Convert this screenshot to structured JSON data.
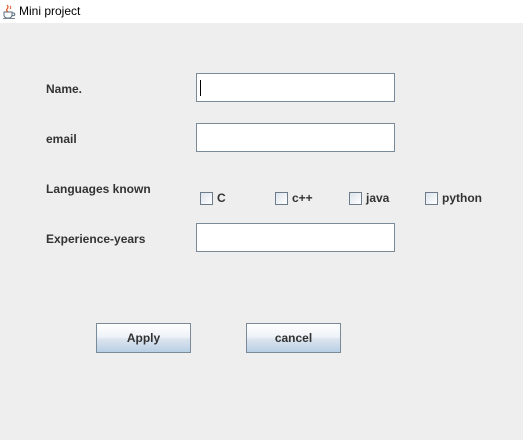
{
  "window": {
    "title": "Mini project",
    "icon": "java-cup-icon"
  },
  "form": {
    "name_label": "Name.",
    "name_value": "",
    "email_label": "email",
    "email_value": "",
    "languages_label": "Languages known",
    "languages": [
      {
        "label": "C",
        "checked": false
      },
      {
        "label": "c++",
        "checked": false
      },
      {
        "label": "java",
        "checked": false
      },
      {
        "label": "python",
        "checked": false
      }
    ],
    "experience_label": "Experience-years",
    "experience_value": ""
  },
  "buttons": {
    "apply_label": "Apply",
    "cancel_label": "cancel"
  },
  "colors": {
    "background": "#eeeeee",
    "titlebar": "#ffffff",
    "label_text": "#333333",
    "field_border": "#7a8a99",
    "button_gradient_bottom": "#b8cfe5"
  }
}
